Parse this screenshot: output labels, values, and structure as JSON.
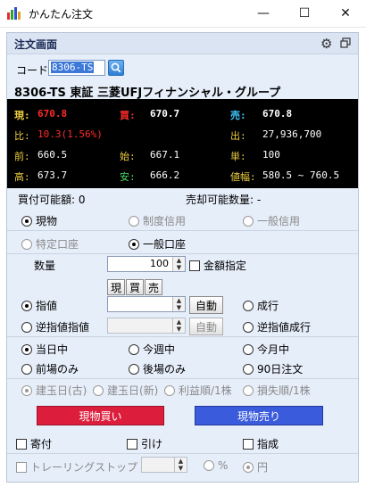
{
  "window": {
    "title": "かんたん注文",
    "min": "—",
    "max": "☐",
    "close": "✕"
  },
  "panel": {
    "title": "注文画面"
  },
  "code": {
    "label": "コード",
    "value": "8306-TS"
  },
  "stock": {
    "name": "8306-TS 東証 三菱UFJフィナンシャル・グループ"
  },
  "quote": {
    "current_label": "現:",
    "current": "670.8",
    "bid_label": "買:",
    "bid": "670.7",
    "ask_label": "売:",
    "ask": "670.8",
    "change_label": "比:",
    "change": "10.3(1.56%)",
    "volume_label": "出:",
    "volume": "27,936,700",
    "prev_label": "前:",
    "prev": "660.5",
    "open_label": "始:",
    "open": "667.1",
    "unit_label": "単:",
    "unit": "100",
    "high_label": "高:",
    "high": "673.7",
    "low_label": "安:",
    "low": "666.2",
    "range_label": "値幅:",
    "range": "580.5 ~ 760.5"
  },
  "buyable": "買付可能額: 0",
  "sellable": "売却可能数量: -",
  "trade_type": [
    "現物",
    "制度信用",
    "一般信用"
  ],
  "account": [
    "特定口座",
    "一般口座"
  ],
  "quantity": {
    "label": "数量",
    "value": "100",
    "check": "金額指定"
  },
  "price_buttons": [
    "現",
    "買",
    "売"
  ],
  "order_types": {
    "limit": "指値",
    "auto": "自動",
    "market": "成行",
    "stop_limit": "逆指値指値",
    "auto2": "自動",
    "stop_market": "逆指値成行"
  },
  "periods": [
    "当日中",
    "今週中",
    "今月中",
    "前場のみ",
    "後場のみ",
    "90日注文"
  ],
  "close_order": [
    "建玉日(古)",
    "建玉日(新)",
    "利益順/1株",
    "損失順/1株"
  ],
  "actions": {
    "buy": "現物買い",
    "sell": "現物売り"
  },
  "conditions": [
    "寄付",
    "引け",
    "指成"
  ],
  "trailing": {
    "label": "トレーリングストップ",
    "percent": "%",
    "yen": "円"
  }
}
